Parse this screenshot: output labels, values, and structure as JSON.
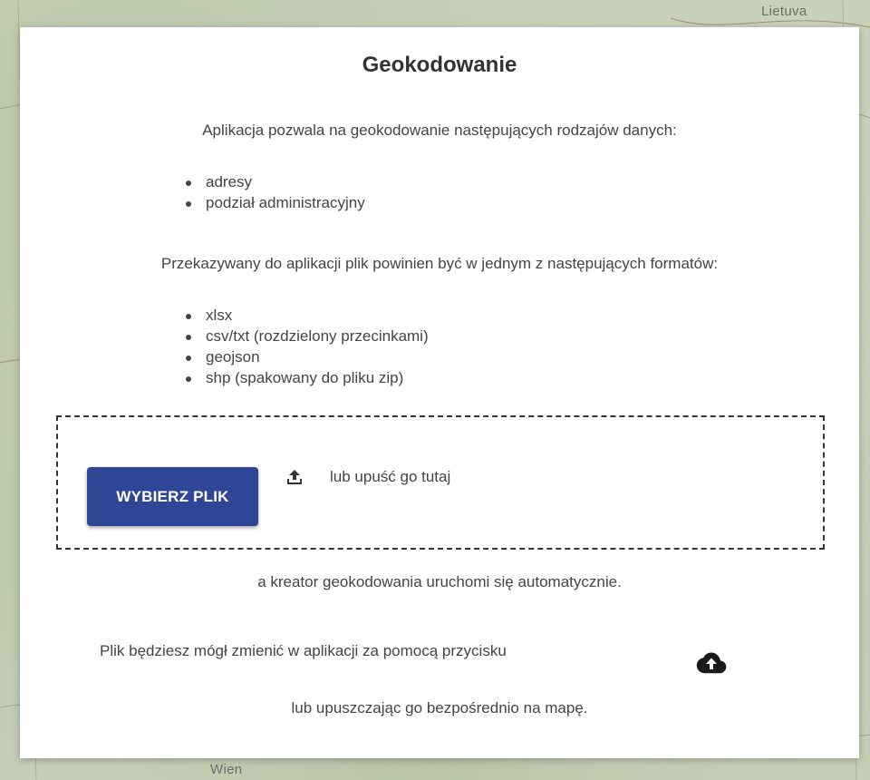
{
  "map": {
    "label_top_right": "Lietuva",
    "label_bottom": "Wien"
  },
  "dialog": {
    "title": "Geokodowanie",
    "intro": "Aplikacja pozwala na geokodowanie następujących rodzajów danych:",
    "data_types": [
      "adresy",
      "podział administracyjny"
    ],
    "formats_intro": "Przekazywany do aplikacji plik powinien być w jednym z następujących formatów:",
    "formats": [
      "xlsx",
      "csv/txt (rozdzielony przecinkami)",
      "geojson",
      "shp (spakowany do pliku zip)"
    ],
    "dropzone": {
      "button_label": "WYBIERZ PLIK",
      "drop_label": "lub upuść go tutaj",
      "icon": "upload-icon"
    },
    "after_text": "a kreator geokodowania uruchomi się automatycznie.",
    "change_text": "Plik będziesz mógł zmienić w aplikacji za pomocą przycisku",
    "change_icon": "cloud-upload-icon",
    "map_drop_text": "lub upuszczając go bezpośrednio na mapę."
  },
  "colors": {
    "button": "#2f4696",
    "text": "#444444",
    "title": "#333333"
  }
}
